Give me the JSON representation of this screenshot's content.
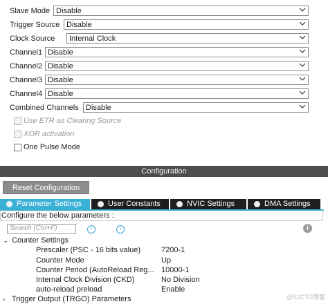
{
  "mode": {
    "rows": [
      {
        "label": "Slave Mode",
        "value": "Disable"
      },
      {
        "label": "Trigger Source",
        "value": "Disable"
      },
      {
        "label": "Clock Source",
        "value": "Internal Clock"
      },
      {
        "label": "Channel1",
        "value": "Disable"
      },
      {
        "label": "Channel2",
        "value": "Disable"
      },
      {
        "label": "Channel3",
        "value": "Disable"
      },
      {
        "label": "Channel4",
        "value": "Disable"
      },
      {
        "label": "Combined Channels",
        "value": "Disable"
      }
    ],
    "checks": [
      {
        "label": "Use ETR as Clearing Source",
        "enabled": false,
        "checked": false
      },
      {
        "label": "XOR activation",
        "enabled": false,
        "checked": false
      },
      {
        "label": "One Pulse Mode",
        "enabled": true,
        "checked": false
      }
    ]
  },
  "config": {
    "title": "Configuration",
    "reset_label": "Reset Configuration",
    "tabs": [
      {
        "label": "Parameter Settings",
        "active": true
      },
      {
        "label": "User Constants",
        "active": false
      },
      {
        "label": "NVIC Settings",
        "active": false
      },
      {
        "label": "DMA Settings",
        "active": false
      }
    ],
    "configure_text": "Configure the below parameters :",
    "search_placeholder": "Search (Ctrl+F)",
    "prev_glyph": "‹",
    "next_glyph": "›",
    "info_glyph": "i",
    "groups": [
      {
        "title": "Counter Settings",
        "expanded": true,
        "params": [
          {
            "name": "Prescaler (PSC - 16 bits value)",
            "value": "7200-1"
          },
          {
            "name": "Counter Mode",
            "value": "Up"
          },
          {
            "name": "Counter Period (AutoReload Reg...",
            "value": "10000-1"
          },
          {
            "name": "Internal Clock Division (CKD)",
            "value": "No Division"
          },
          {
            "name": "auto-reload preload",
            "value": "Enable"
          }
        ]
      },
      {
        "title": "Trigger Output (TRGO) Parameters",
        "expanded": false,
        "params": []
      }
    ]
  },
  "watermark": "@51CTO博客",
  "colors": {
    "tab_active": "#3bb0d6",
    "tab_inactive": "#1f1f1f",
    "config_bar": "#4d4d4d"
  }
}
